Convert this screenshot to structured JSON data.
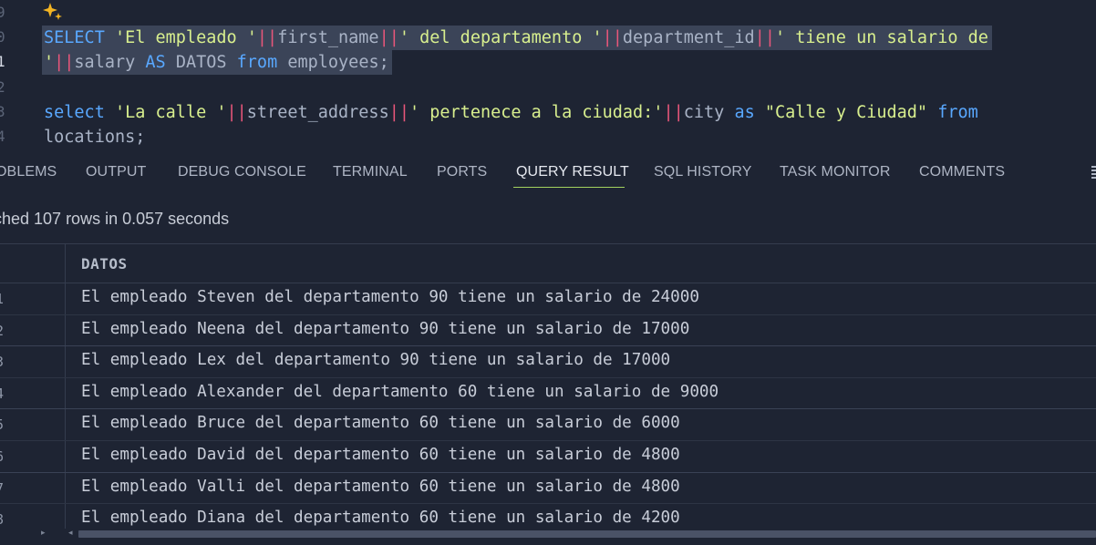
{
  "editor": {
    "line_numbers": [
      "9",
      "0",
      "1",
      "2",
      "3",
      "4"
    ],
    "active_line": "1",
    "line1": {
      "kw_select": "SELECT",
      "str1": "'El empleado '",
      "op1": "||",
      "id1": "first_name",
      "op2": "||",
      "str2": "' del departamento '",
      "op3": "||",
      "id2": "department_id",
      "op4": "||",
      "str3": "' tiene un salario de"
    },
    "line2": {
      "str4": "'",
      "op5": "||",
      "id3": "salary",
      "kw_as": "AS",
      "id4": "DATOS",
      "kw_from": "from",
      "id5": "employees;"
    },
    "line4": {
      "kw_select": "select",
      "str1": "'La calle '",
      "op1": "||",
      "id1": "street_address",
      "op2": "||",
      "str2": "' pertenece a la ciudad:'",
      "op3": "||",
      "id2": "city",
      "kw_as": "as",
      "str3": "\"Calle y Ciudad\"",
      "kw_from": "from"
    },
    "line5": {
      "id1": "locations;"
    }
  },
  "tabs": [
    {
      "label": "OBLEMS"
    },
    {
      "label": "OUTPUT"
    },
    {
      "label": "DEBUG CONSOLE"
    },
    {
      "label": "TERMINAL"
    },
    {
      "label": "PORTS"
    },
    {
      "label": "QUERY RESULT"
    },
    {
      "label": "SQL HISTORY"
    },
    {
      "label": "TASK MONITOR"
    },
    {
      "label": "COMMENTS"
    }
  ],
  "active_tab": "QUERY RESULT",
  "status": {
    "text": "tched 107 rows in 0.057 seconds"
  },
  "table": {
    "header": "DATOS",
    "rows": [
      {
        "num": "1",
        "value": "El empleado Steven del departamento 90 tiene un salario de 24000"
      },
      {
        "num": "2",
        "value": "El empleado Neena del departamento 90 tiene un salario de 17000"
      },
      {
        "num": "3",
        "value": "El empleado Lex del departamento 90 tiene un salario de 17000"
      },
      {
        "num": "4",
        "value": "El empleado Alexander del departamento 60 tiene un salario de 9000"
      },
      {
        "num": "5",
        "value": "El empleado Bruce del departamento 60 tiene un salario de 6000"
      },
      {
        "num": "6",
        "value": "El empleado David del departamento 60 tiene un salario de 4800"
      },
      {
        "num": "7",
        "value": "El empleado Valli del departamento 60 tiene un salario de 4800"
      },
      {
        "num": "8",
        "value": "El empleado Diana del departamento 60 tiene un salario de 4200"
      }
    ]
  },
  "colors": {
    "background": "#1e2433",
    "keyword": "#59a8ff",
    "string": "#d8ef8e",
    "operator": "#e8567a",
    "identifier": "#a9b3c6",
    "selection": "#3b4458",
    "active_tab_underline": "#a3d15f"
  },
  "icons": {
    "sparkle": "sparkle-icon",
    "more": "more-vertical-icon",
    "scroll_left": "scroll-left-arrow-icon",
    "scroll_right": "scroll-right-arrow-icon"
  }
}
